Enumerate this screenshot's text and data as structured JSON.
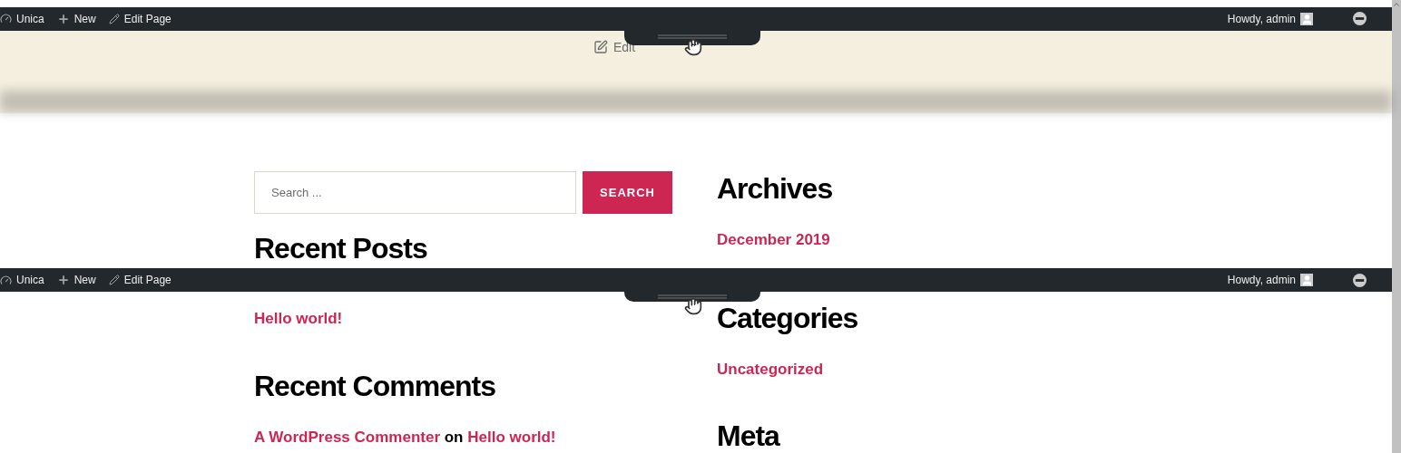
{
  "admin_bars": [
    {
      "site": "Unica",
      "new": "New",
      "edit_page": "Edit Page",
      "greeting": "Howdy, admin"
    },
    {
      "site": "Unica",
      "new": "New",
      "edit_page": "Edit Page",
      "greeting": "Howdy, admin"
    }
  ],
  "header": {
    "edit_link": "Edit"
  },
  "search": {
    "placeholder": "Search ...",
    "button": "SEARCH"
  },
  "left_widgets": [
    {
      "kind": "links",
      "title": "Recent Posts",
      "links": [
        "Hello world!"
      ]
    },
    {
      "kind": "comment",
      "title": "Recent Comments",
      "author": "A WordPress Commenter",
      "joiner": "on",
      "post": "Hello world!"
    }
  ],
  "right_widgets": [
    {
      "kind": "links",
      "title": "Archives",
      "links": [
        "December 2019"
      ]
    },
    {
      "kind": "links",
      "title": "Categories",
      "links": [
        "Uncategorized"
      ]
    },
    {
      "kind": "links",
      "title": "Meta"
    }
  ]
}
